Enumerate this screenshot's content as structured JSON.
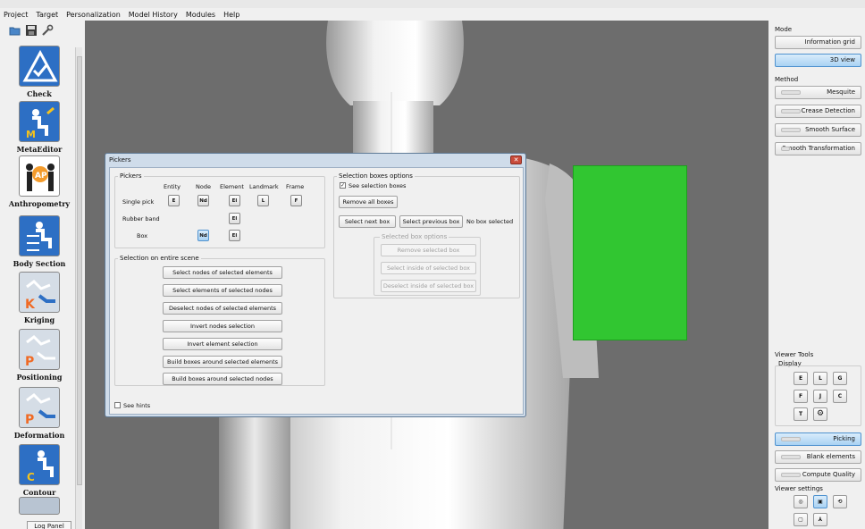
{
  "menu": [
    "Project",
    "Target",
    "Personalization",
    "Model History",
    "Modules",
    "Help"
  ],
  "left_modules": [
    {
      "label": "Check",
      "icon": "check-icon"
    },
    {
      "label": "MetaEditor",
      "icon": "metaeditor-icon"
    },
    {
      "label": "Anthropometry",
      "icon": "anthropometry-icon"
    },
    {
      "label": "Body Section",
      "icon": "body-section-icon"
    },
    {
      "label": "Kriging",
      "icon": "kriging-icon"
    },
    {
      "label": "Positioning",
      "icon": "positioning-icon"
    },
    {
      "label": "Deformation",
      "icon": "deformation-icon"
    },
    {
      "label": "Contour",
      "icon": "contour-icon"
    }
  ],
  "log_panel": "Log Panel",
  "right_panel": {
    "mode_label": "Mode",
    "mode_buttons": [
      "Information grid",
      "3D view"
    ],
    "method_label": "Method",
    "method_buttons": [
      "Mesquite",
      "Crease Detection",
      "Smooth Surface",
      "Smooth Transformation"
    ],
    "viewer_tools_label": "Viewer Tools",
    "display_label": "Display",
    "display_buttons": [
      "E",
      "L",
      "G",
      "F",
      "J",
      "C",
      "T",
      "gear"
    ],
    "action_buttons": [
      "Picking",
      "Blank elements",
      "Compute Quality"
    ],
    "viewer_settings_label": "Viewer settings"
  },
  "pickers": {
    "title": "Pickers",
    "pickers_group": {
      "title": "Pickers",
      "columns": [
        "Entity",
        "Node",
        "Element",
        "Landmark",
        "Frame"
      ],
      "single_pick": "Single pick",
      "single_icons": [
        "E",
        "Nd",
        "El",
        "L",
        "F"
      ],
      "rubber_band": "Rubber band",
      "rubber_icons": [
        "El"
      ],
      "box": "Box",
      "box_icons": [
        "Nd",
        "El"
      ]
    },
    "scene_group": {
      "title": "Selection on entire scene",
      "buttons": [
        "Select nodes of selected elements",
        "Select elements of selected nodes",
        "Deselect nodes of selected elements",
        "Invert nodes selection",
        "Invert element selection",
        "Build boxes around selected elements",
        "Build boxes around selected nodes"
      ]
    },
    "boxes_group": {
      "title": "Selection boxes options",
      "see_boxes": "See selection boxes",
      "see_boxes_checked": true,
      "remove_all": "Remove all boxes",
      "select_next": "Select next box",
      "select_previous": "Select previous box",
      "status": "No box selected",
      "selected_options_title": "Selected box options",
      "selected_buttons": [
        "Remove selected box",
        "Select inside of selected box",
        "Deselect inside of selected box"
      ]
    },
    "see_hints": "See hints",
    "see_hints_checked": false
  }
}
